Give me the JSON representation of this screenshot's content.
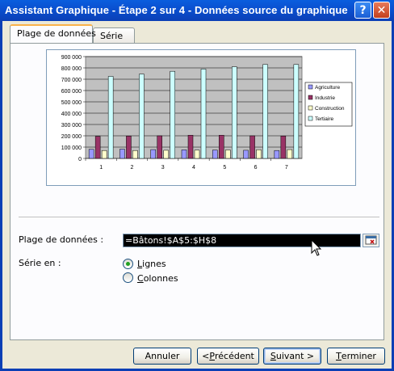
{
  "window": {
    "title": "Assistant Graphique - Étape 2 sur 4 - Données source du graphique",
    "help_label": "?",
    "close_label": "✕"
  },
  "tabs": [
    {
      "label": "Plage de données",
      "active": true
    },
    {
      "label": "Série",
      "active": false
    }
  ],
  "chart_data": {
    "type": "bar",
    "categories": [
      "1",
      "2",
      "3",
      "4",
      "5",
      "6",
      "7"
    ],
    "series": [
      {
        "name": "Agriculture",
        "color": "#9999ff",
        "values": [
          80000,
          82000,
          78000,
          76000,
          74000,
          72000,
          70000
        ]
      },
      {
        "name": "Industrie",
        "color": "#993366",
        "values": [
          195000,
          198000,
          200000,
          205000,
          205000,
          200000,
          198000
        ]
      },
      {
        "name": "Construction",
        "color": "#ffffcc",
        "values": [
          70000,
          70000,
          72000,
          73000,
          75000,
          77000,
          78000
        ]
      },
      {
        "name": "Tertiaire",
        "color": "#ccffff",
        "values": [
          725000,
          745000,
          770000,
          790000,
          810000,
          830000,
          830000
        ]
      }
    ],
    "yticks": [
      "0",
      "100 000",
      "200 000",
      "300 000",
      "400 000",
      "500 000",
      "600 000",
      "700 000",
      "800 000",
      "900 000"
    ],
    "ylim": [
      0,
      900000
    ],
    "plot_background": "#c0c0c0",
    "grid": true,
    "legend_position": "right"
  },
  "form": {
    "range_label": "Plage de données :",
    "range_value": "=Bâtons!$A$5:$H$8",
    "series_in_label": "Série en :",
    "options": [
      {
        "label": "Lignes",
        "selected": true
      },
      {
        "label": "Colonnes",
        "selected": false
      }
    ]
  },
  "buttons": {
    "cancel": "Annuler",
    "previous": "< Précédent",
    "next": "Suivant >",
    "finish": "Terminer"
  }
}
